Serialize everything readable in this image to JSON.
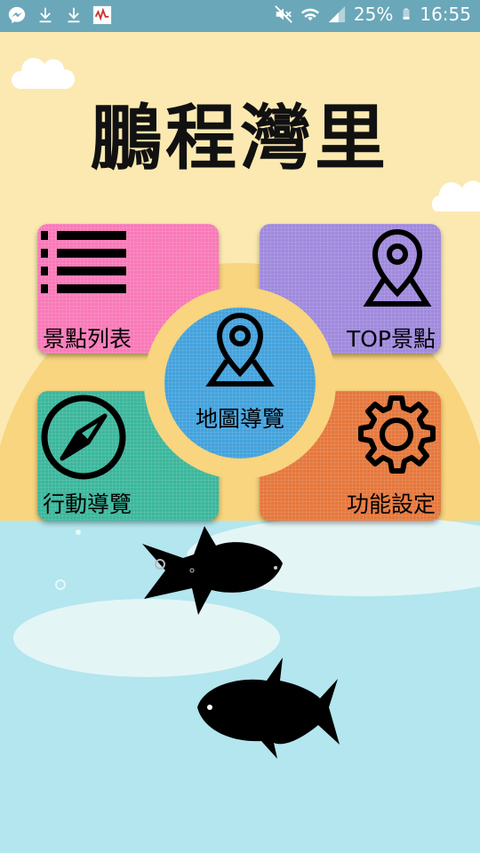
{
  "status_bar": {
    "battery": "25%",
    "time": "16:55",
    "icons": [
      "messenger-icon",
      "download-icon",
      "download-icon",
      "app-thumbnail-icon",
      "mute-icon",
      "wifi-icon",
      "signal-icon",
      "battery-icon"
    ]
  },
  "app": {
    "title": "鵬程灣里",
    "menu": {
      "list": "景點列表",
      "top": "TOP景點",
      "map": "地圖導覽",
      "mobile_nav": "行動導覽",
      "settings": "功能設定"
    }
  },
  "colors": {
    "sky": "#fbe9b1",
    "sun": "#f8d57e",
    "sea": "#b3e6ee",
    "list_tile": "#f879b8",
    "top_tile": "#9f89dc",
    "map_circle": "#43a2dc",
    "nav_tile": "#3bb79c",
    "settings_tile": "#e5773c"
  }
}
